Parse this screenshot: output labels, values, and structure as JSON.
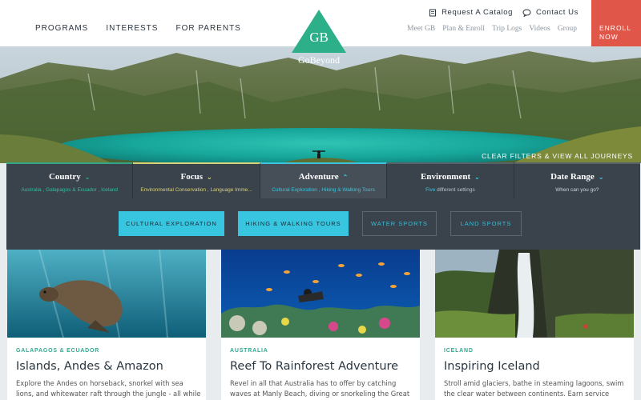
{
  "header": {
    "main_nav": [
      "PROGRAMS",
      "INTERESTS",
      "FOR PARENTS"
    ],
    "logo_text": "GoBeyond",
    "logo_mark": "GB",
    "util_nav": [
      {
        "icon": "catalog-icon",
        "label": "Request A Catalog"
      },
      {
        "icon": "chat-icon",
        "label": "Contact Us"
      }
    ],
    "secondary_nav": [
      "Meet GB",
      "Plan & Enroll",
      "Trip Logs",
      "Videos",
      "Group"
    ],
    "enroll_label": [
      "ENROLL",
      "NOW"
    ]
  },
  "hero": {
    "clear_filters": "CLEAR FILTERS & VIEW ALL JOURNEYS"
  },
  "filters": [
    {
      "label": "Country",
      "sub": "Australia , Galapagos & Ecuador , Iceland",
      "sub_color": "#2fbfa0",
      "expanded": false
    },
    {
      "label": "Focus",
      "sub": "Environmental Conservation , Language Imme...",
      "sub_color": "#d8d27c",
      "expanded": false
    },
    {
      "label": "Adventure",
      "sub": "Cultural Exploration , Hiking & Walking Tours",
      "sub_color": "#3bc4de",
      "expanded": true
    },
    {
      "label": "Environment",
      "sub_strong": "Five",
      "sub": " different settings",
      "sub_color": "#b8c2ca",
      "expanded": false
    },
    {
      "label": "Date Range",
      "sub": "When can you go?",
      "sub_color": "#d0d6db",
      "expanded": false
    }
  ],
  "adventure_options": [
    {
      "label": "CULTURAL EXPLORATION",
      "selected": true
    },
    {
      "label": "HIKING & WALKING TOURS",
      "selected": true
    },
    {
      "label": "WATER SPORTS",
      "selected": false
    },
    {
      "label": "LAND SPORTS",
      "selected": false
    }
  ],
  "cards": [
    {
      "tag": "GALAPAGOS & ECUADOR",
      "title": "Islands, Andes & Amazon",
      "desc": "Explore the Andes on horseback, snorkel with sea lions, and whitewater raft through the jungle - all while finding"
    },
    {
      "tag": "AUSTRALIA",
      "title": "Reef To Rainforest Adventure",
      "desc": "Revel in all that Australia has to offer by catching waves at Manly Beach, diving or snorkeling the Great Barrier"
    },
    {
      "tag": "ICELAND",
      "title": "Inspiring Iceland",
      "desc": "Stroll amid glaciers, bathe in steaming lagoons, swim the clear water between continents. Earn service credit"
    }
  ],
  "colors": {
    "accent_teal": "#2db08a",
    "accent_cyan": "#38c5e0",
    "enroll_red": "#e0574a",
    "filter_bg": "#3a434c"
  }
}
